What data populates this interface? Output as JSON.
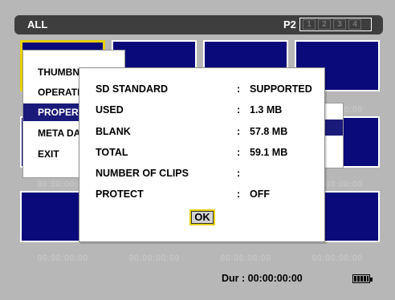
{
  "topbar": {
    "slot_filter": "ALL",
    "card_label": "P2",
    "slots": [
      "1",
      "2",
      "3",
      "4"
    ]
  },
  "thumbnails": {
    "timecode": "00:00:00:00",
    "fill_color": "#0a0a7a",
    "selected_border_color": "#e8d000"
  },
  "menu": {
    "items": [
      {
        "label": "THUMBNAIL"
      },
      {
        "label": "OPERATION"
      },
      {
        "label": "PROPERTY"
      },
      {
        "label": "META DATA"
      },
      {
        "label": "EXIT"
      }
    ],
    "active_index": 2
  },
  "dialog": {
    "rows": [
      {
        "key": "SD STANDARD",
        "value": "SUPPORTED"
      },
      {
        "key": "USED",
        "value": "1.3 MB"
      },
      {
        "key": "BLANK",
        "value": "57.8 MB"
      },
      {
        "key": "TOTAL",
        "value": "59.1 MB"
      },
      {
        "key": "NUMBER OF CLIPS",
        "value": ""
      },
      {
        "key": "PROTECT",
        "value": "OFF"
      }
    ],
    "ok_label": "OK"
  },
  "status": {
    "duration": "Dur : 00:00:00:00",
    "battery_icon": "battery-icon"
  }
}
